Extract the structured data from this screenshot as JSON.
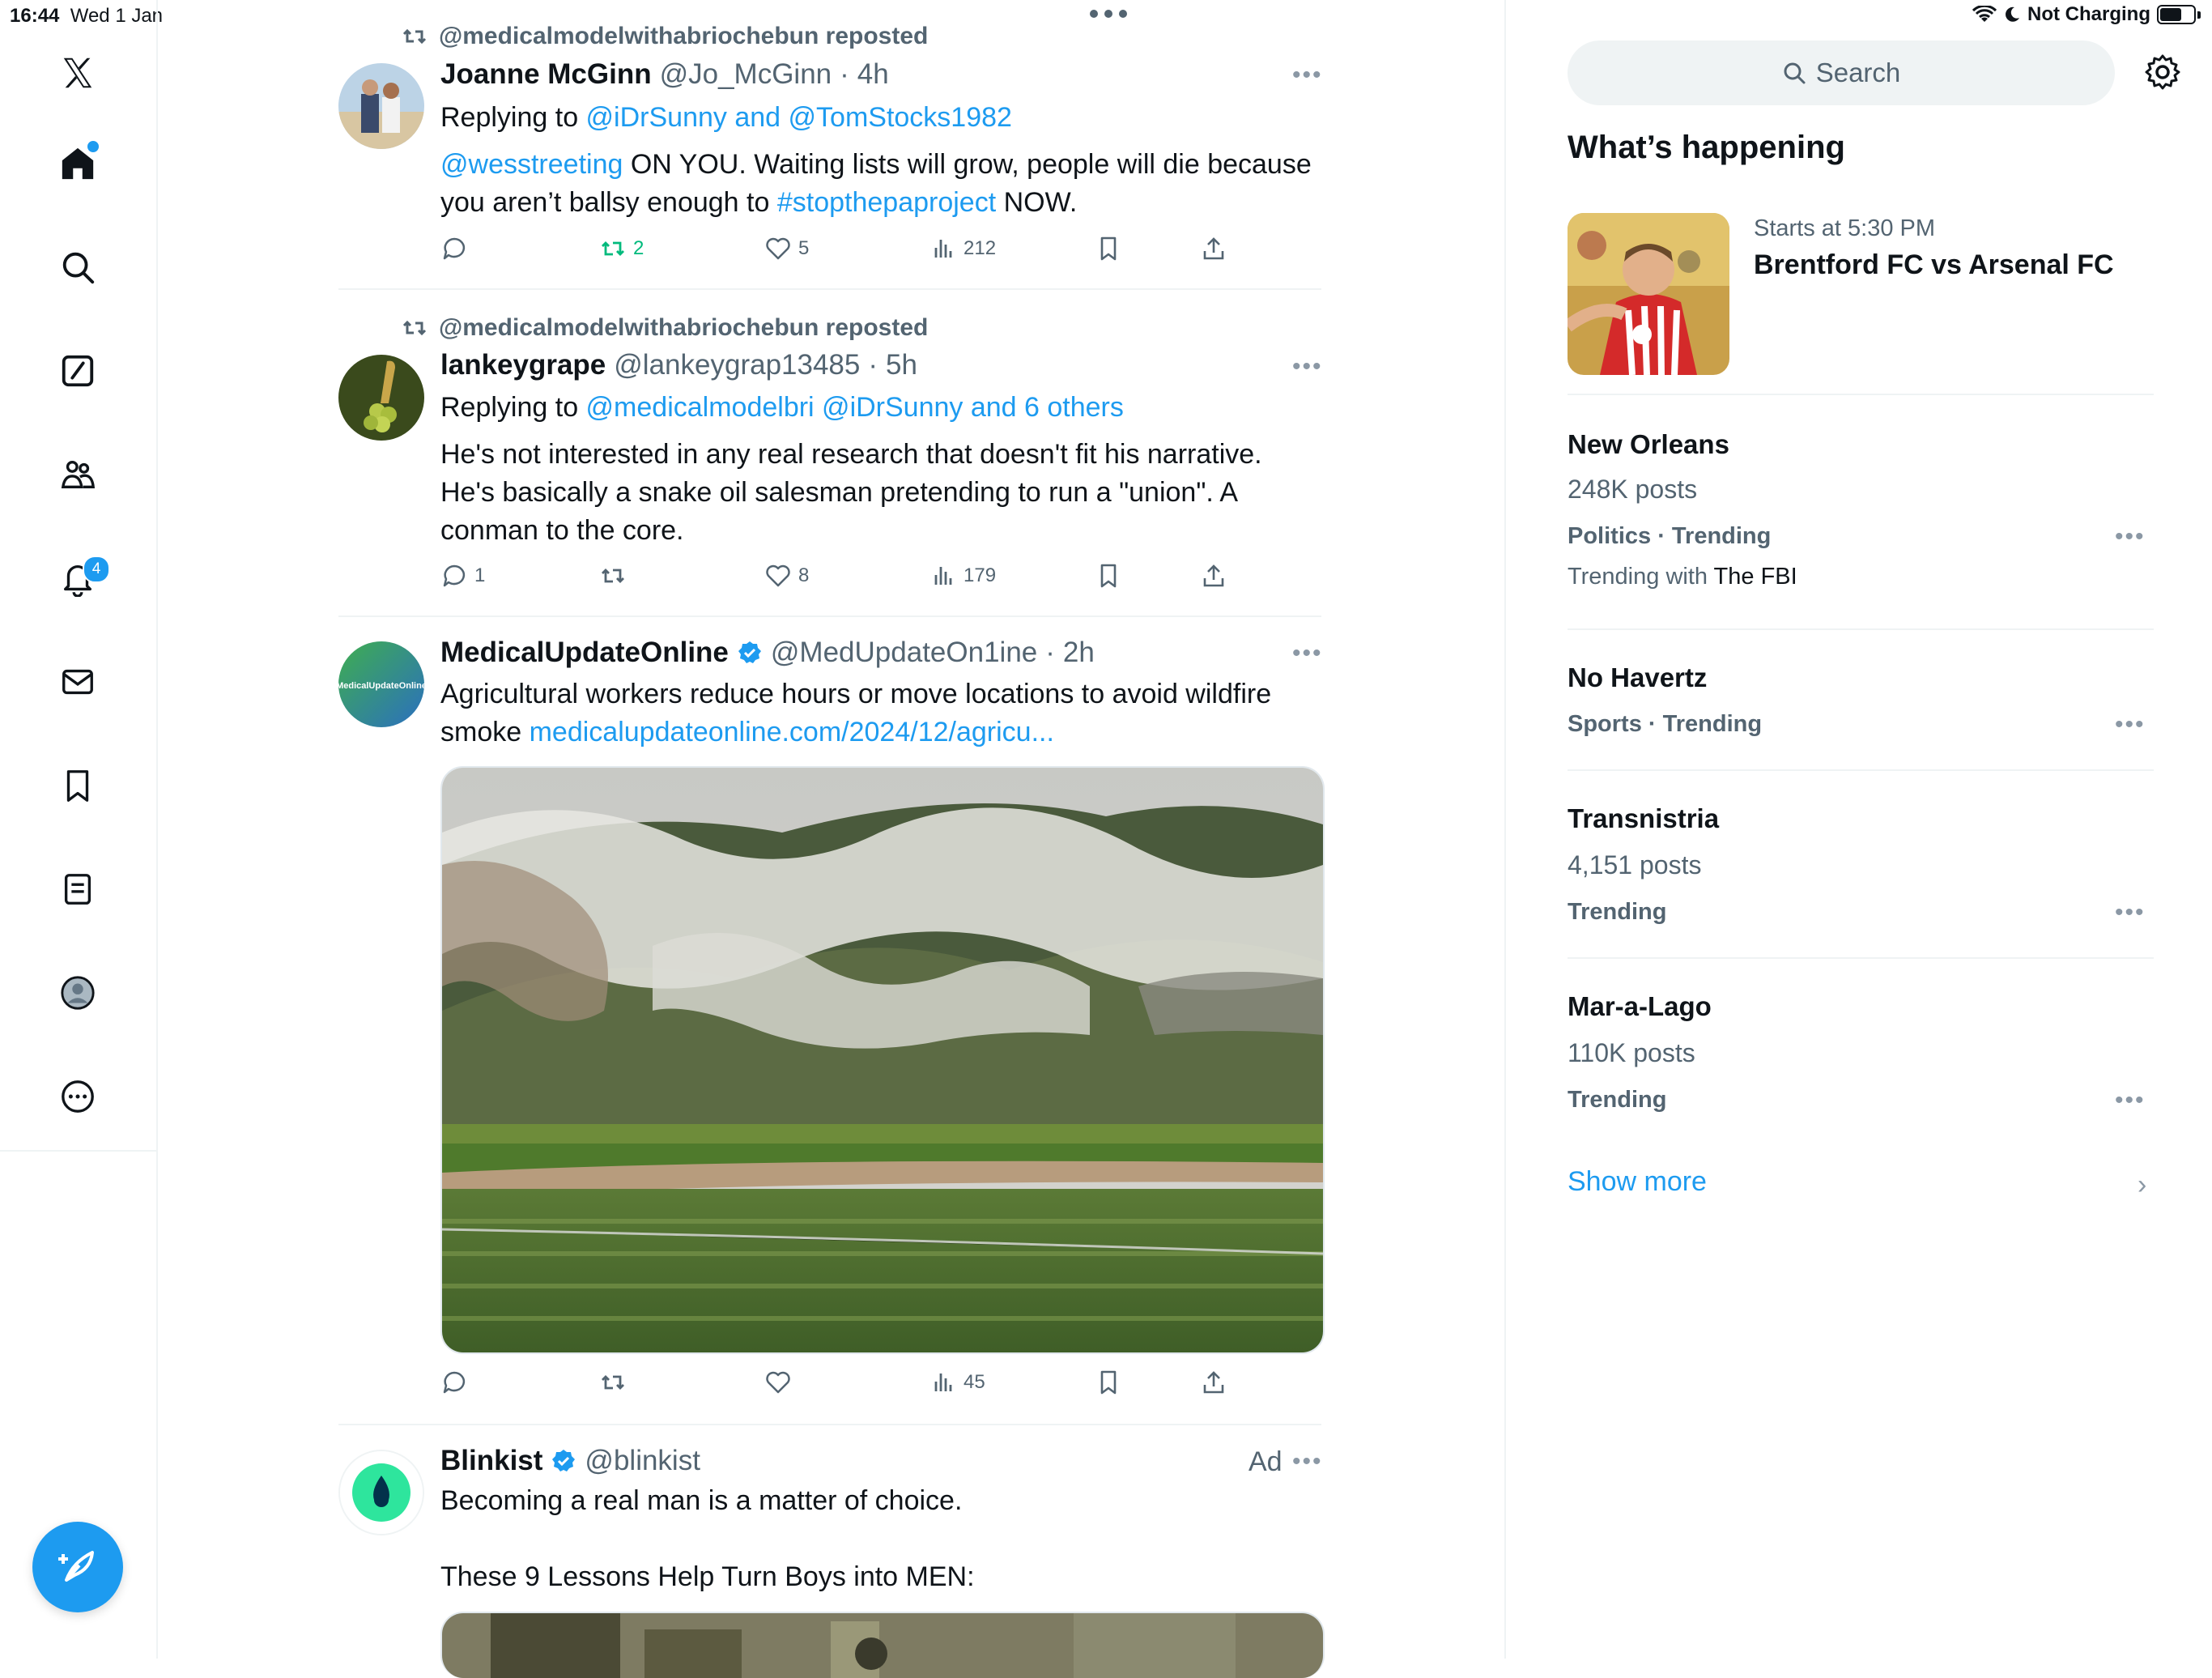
{
  "status_bar": {
    "time": "16:44",
    "date": "Wed 1 Jan",
    "charging": "Not Charging"
  },
  "nav": {
    "items": [
      "home-icon",
      "search-icon",
      "grok-icon",
      "communities-icon",
      "notifications-icon",
      "messages-icon",
      "bookmarks-icon",
      "lists-icon",
      "profile-icon",
      "more-icon"
    ],
    "notifications_badge": "4",
    "accent": "#1d9bf0"
  },
  "tweets": [
    {
      "reposted_by": "@medicalmodelwithabriochebun reposted",
      "name": "Joanne McGinn",
      "handle": "@Jo_McGinn",
      "dot": "·",
      "time": "4h",
      "replying_prefix": "Replying to ",
      "replying_to": "@iDrSunny and @TomStocks1982",
      "text_mention": "@wesstreeting",
      "text_a": " ON YOU. Waiting lists will grow, people will die because you aren’t ballsy enough to ",
      "text_hashtag": "#stopthepaproject",
      "text_b": " NOW.",
      "replies": "",
      "reposts": "2",
      "likes": "5",
      "views": "212"
    },
    {
      "reposted_by": "@medicalmodelwithabriochebun reposted",
      "name": "lankeygrape",
      "handle": "@lankeygrap13485",
      "dot": "·",
      "time": "5h",
      "replying_prefix": "Replying to ",
      "replying_to": "@medicalmodelbri @iDrSunny and 6 others",
      "text": "He's not interested in any real research that doesn't fit his narrative. He's basically a snake oil salesman pretending to run a \"union\". A conman to the core.",
      "replies": "1",
      "reposts": "",
      "likes": "8",
      "views": "179"
    },
    {
      "name": "MedicalUpdateOnline",
      "handle": "@MedUpdateOn1ine",
      "dot": "·",
      "time": "2h",
      "avatar_text": "MedicalUpdateOnline",
      "text": "Agricultural workers reduce hours or move locations to avoid wildfire smoke ",
      "link": "medicalupdateonline.com/2024/12/agricu...",
      "replies": "",
      "reposts": "",
      "likes": "",
      "views": "45"
    },
    {
      "name": "Blinkist",
      "handle": "@blinkist",
      "ad": "Ad",
      "text_1": "Becoming a real man is a matter of choice.",
      "text_2": "These 9 Lessons Help Turn Boys into MEN:"
    }
  ],
  "sidebar": {
    "search_placeholder": "Search",
    "title": "What’s happening",
    "event": {
      "time": "Starts at 5:30 PM",
      "title": "Brentford FC vs Arsenal FC"
    },
    "trends": [
      {
        "name": "New Orleans",
        "posts": "248K posts",
        "category": "Politics · Trending",
        "with_prefix": "Trending with ",
        "with_name": "The FBI"
      },
      {
        "name": "No Havertz",
        "category": "Sports · Trending"
      },
      {
        "name": "Transnistria",
        "posts": "4,151 posts",
        "category": "Trending"
      },
      {
        "name": "Mar-a-Lago",
        "posts": "110K posts",
        "category": "Trending"
      }
    ],
    "show_more": "Show more"
  }
}
